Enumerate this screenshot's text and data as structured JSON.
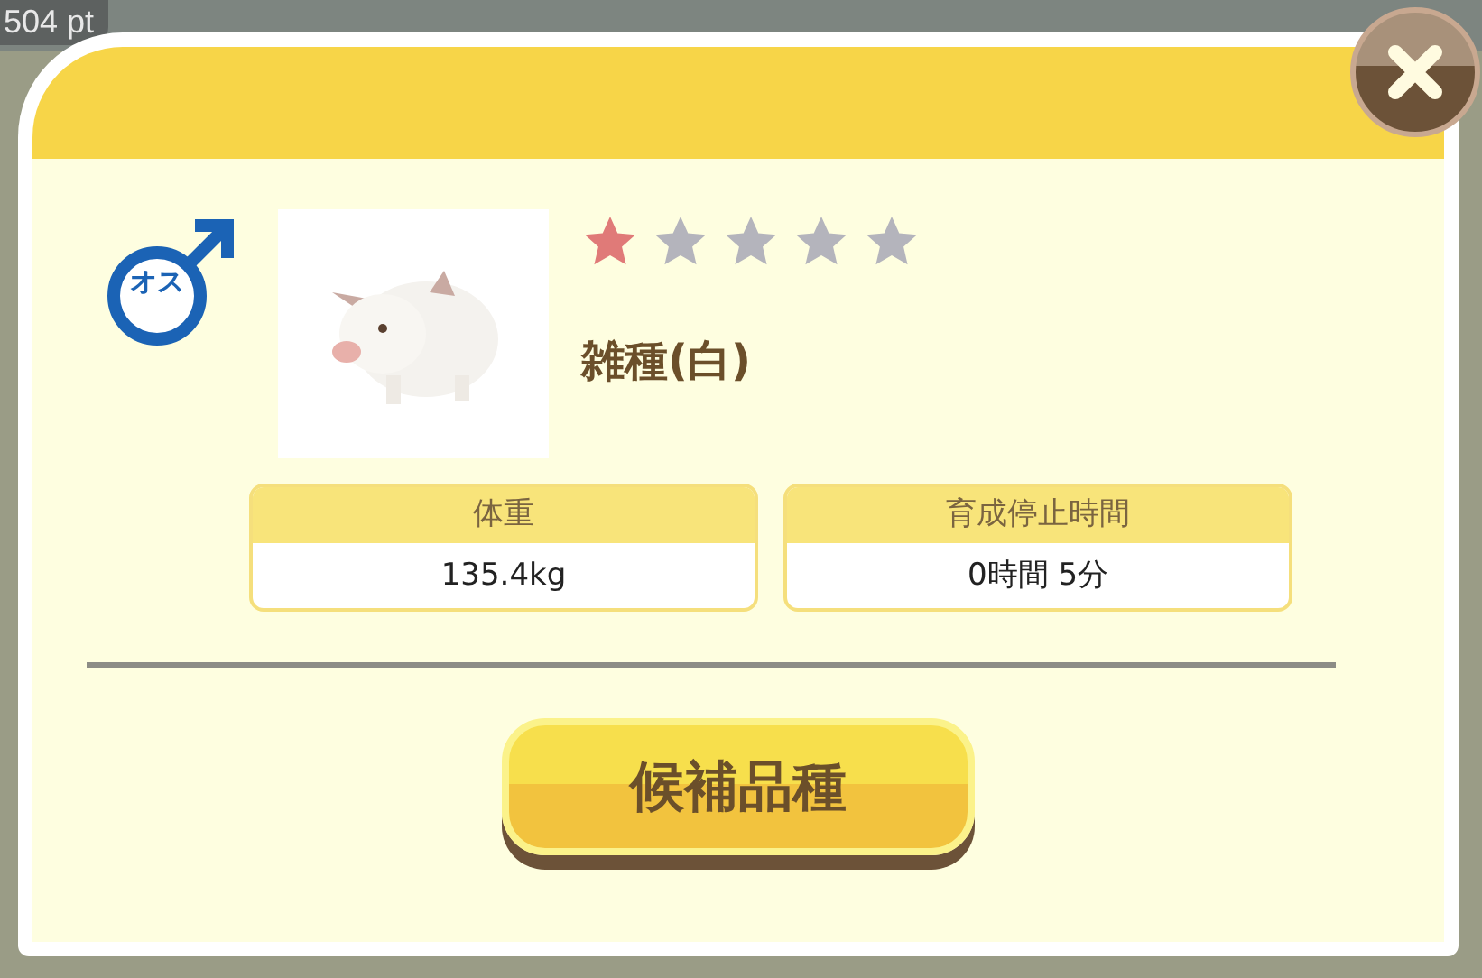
{
  "background": {
    "points": "504 pt"
  },
  "dialog": {
    "gender": {
      "kind": "male",
      "label": "オス"
    },
    "animal": {
      "stars": 1,
      "name": "雑種(白)"
    },
    "stats": [
      {
        "label": "体重",
        "value": "135.4kg"
      },
      {
        "label": "育成停止時間",
        "value": "0時間 5分"
      }
    ],
    "button": "候補品種"
  }
}
